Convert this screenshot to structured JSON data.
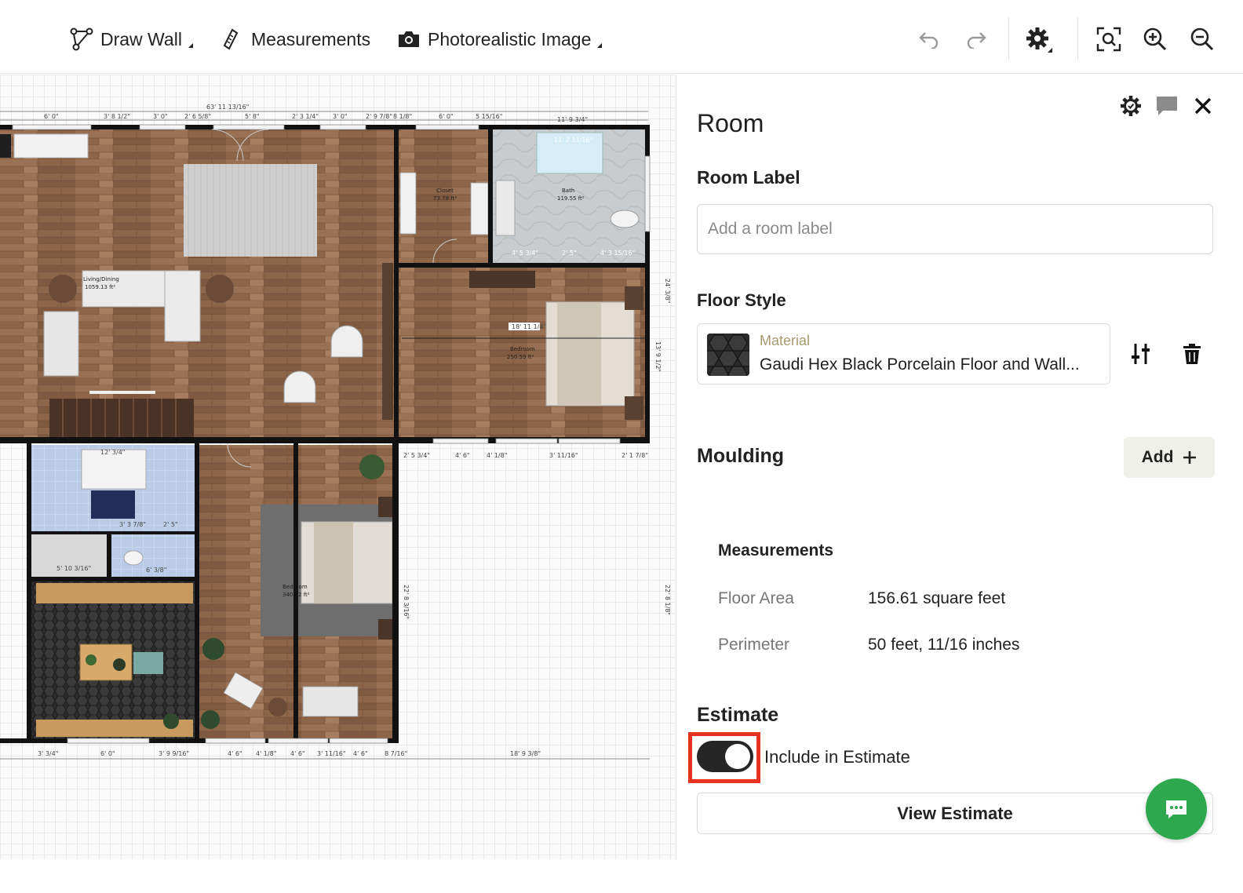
{
  "toolbar": {
    "draw_wall": "Draw Wall",
    "measurements": "Measurements",
    "photorealistic": "Photorealistic Image",
    "icons": [
      "draw-wall-icon",
      "ruler-icon",
      "camera-icon",
      "undo-icon",
      "redo-icon",
      "settings-icon",
      "fit-view-icon",
      "zoom-in-icon",
      "zoom-out-icon"
    ]
  },
  "plan": {
    "rooms": {
      "living": {
        "name": "Living/Dining",
        "area": "1059.13 ft²"
      },
      "closet": {
        "name": "Closet",
        "area": "73.78 ft²"
      },
      "bath": {
        "name": "Bath",
        "area": "119.55 ft²"
      },
      "bedroom1": {
        "name": "Bedroom",
        "area": "250.59 ft²"
      },
      "bedroom2": {
        "name": "Bedroom",
        "area": "340.02 ft²"
      }
    },
    "dims": {
      "total_top": "63' 11 13/16\"",
      "d1": "6' 0\"",
      "d2": "3' 8 1/2\"",
      "d3": "3' 0\"",
      "d4": "2' 6 5/8\"",
      "d5": "5' 8\"",
      "d6": "2' 3 1/4\"",
      "d7": "3' 0\"",
      "d8": "2' 9 7/8\"",
      "d9": "8 1/8\"",
      "d10": "6' 0\"",
      "d11": "5 15/16\"",
      "d12": "11' 9 3/4\"",
      "d13": "11' 2 11/16\"",
      "d14": "18' 11 1/4\"",
      "d15": "24' 3/8\"",
      "d16": "13' 9 1/2\"",
      "d17": "22' 8 1/8\"",
      "d18": "22' 8 3/16\"",
      "d19": "18' 9 3/8\"",
      "d20": "2' 5 3/4\"",
      "d21": "4' 6\"",
      "d22": "4' 1/8\"",
      "d23": "3' 11/16\"",
      "d24": "2' 1 7/8\"",
      "d25": "3' 3/4\"",
      "d26": "3' 9 9/16\"",
      "d27": "8 7/16\"",
      "d28": "4' 5 3/4\"",
      "d29": "4' 3 15/16\"",
      "d30": "2' 5\"",
      "d31": "12' 3/4\"",
      "d32": "2' 5\"",
      "d33": "3' 3 7/8\"",
      "d34": "6' 3/8\"",
      "d35": "5' 10 3/16\""
    }
  },
  "panel": {
    "title": "Room",
    "room_label_heading": "Room Label",
    "room_label_placeholder": "Add a room label",
    "room_label_value": "",
    "floor_style_heading": "Floor Style",
    "material_caption": "Material",
    "material_name": "Gaudi Hex Black Porcelain Floor and Wall...",
    "moulding_heading": "Moulding",
    "add_label": "Add",
    "measurements_heading": "Measurements",
    "floor_area_label": "Floor Area",
    "floor_area_value": "156.61 square feet",
    "perimeter_label": "Perimeter",
    "perimeter_value": "50 feet, 11/16 inches",
    "estimate_heading": "Estimate",
    "include_label": "Include in Estimate",
    "include_on": true,
    "view_estimate": "View Estimate",
    "colors": {
      "toggle_on": "#262626",
      "highlight": "#e8321f",
      "chat": "#2ea84f",
      "material_caption": "#a79a6e"
    }
  }
}
